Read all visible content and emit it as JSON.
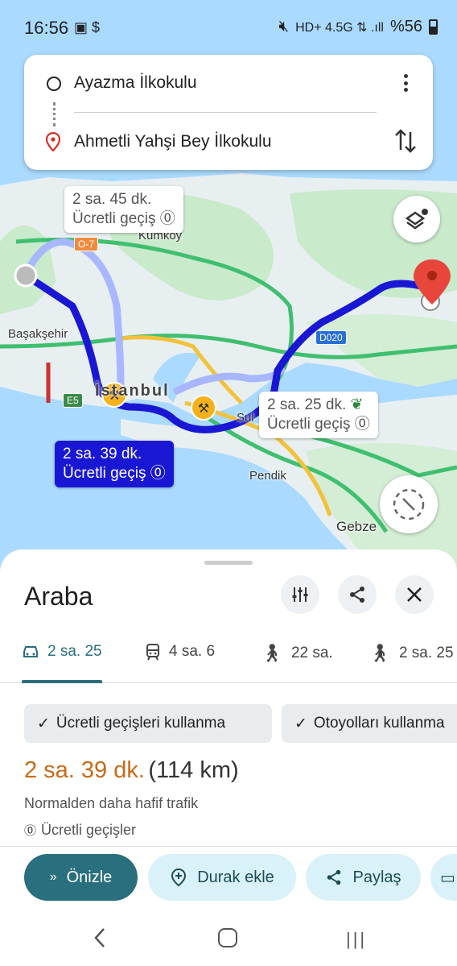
{
  "status_bar": {
    "time": "16:56",
    "left_icons": "▣ $",
    "network": "HD+ 4.5G ⇅ .ıll",
    "battery_text": "%56"
  },
  "directions": {
    "origin": "Ayazma İlkokulu",
    "destination": "Ahmetli Yahşi Bey İlkokulu"
  },
  "map": {
    "route_labels": [
      {
        "time": "2 sa. 45 dk.",
        "note": "Ücretli geçiş"
      },
      {
        "time": "2 sa. 25 dk.",
        "note": "Ücretli geçiş"
      },
      {
        "time": "2 sa. 39 dk.",
        "note": "Ücretli geçiş"
      }
    ],
    "places": {
      "kumkoy": "Kumköy",
      "basaksehir": "Başakşehir",
      "istanbul": "İstanbul",
      "sultanbeyli": "Sul",
      "pendik": "Pendik",
      "gebze": "Gebze"
    },
    "roads": {
      "o7": "O-7",
      "e5": "E5",
      "d020": "D020"
    },
    "colors": {
      "selected_route": "#1a17d4",
      "alt_route": "#a8b7ff",
      "highway": "#3fbf6f",
      "land": "#e6eef0",
      "green": "#c9eacb",
      "water": "#aadaff"
    }
  },
  "sheet": {
    "title": "Araba",
    "modes": [
      {
        "icon": "car-icon",
        "label": "2 sa. 25"
      },
      {
        "icon": "transit-icon",
        "label": "4 sa. 6"
      },
      {
        "icon": "walk-icon",
        "label": "22 sa."
      },
      {
        "icon": "hike-icon",
        "label": "2 sa. 25"
      }
    ],
    "chips": [
      "Ücretli geçişleri kullanma",
      "Otoyolları kullanma"
    ],
    "duration": "2 sa. 39 dk.",
    "distance": "(114 km)",
    "traffic_note": "Normalden daha hafif trafik",
    "toll_note": "Ücretli geçişler",
    "actions": {
      "preview": "Önizle",
      "add_stop": "Durak ekle",
      "share": "Paylaş"
    }
  }
}
